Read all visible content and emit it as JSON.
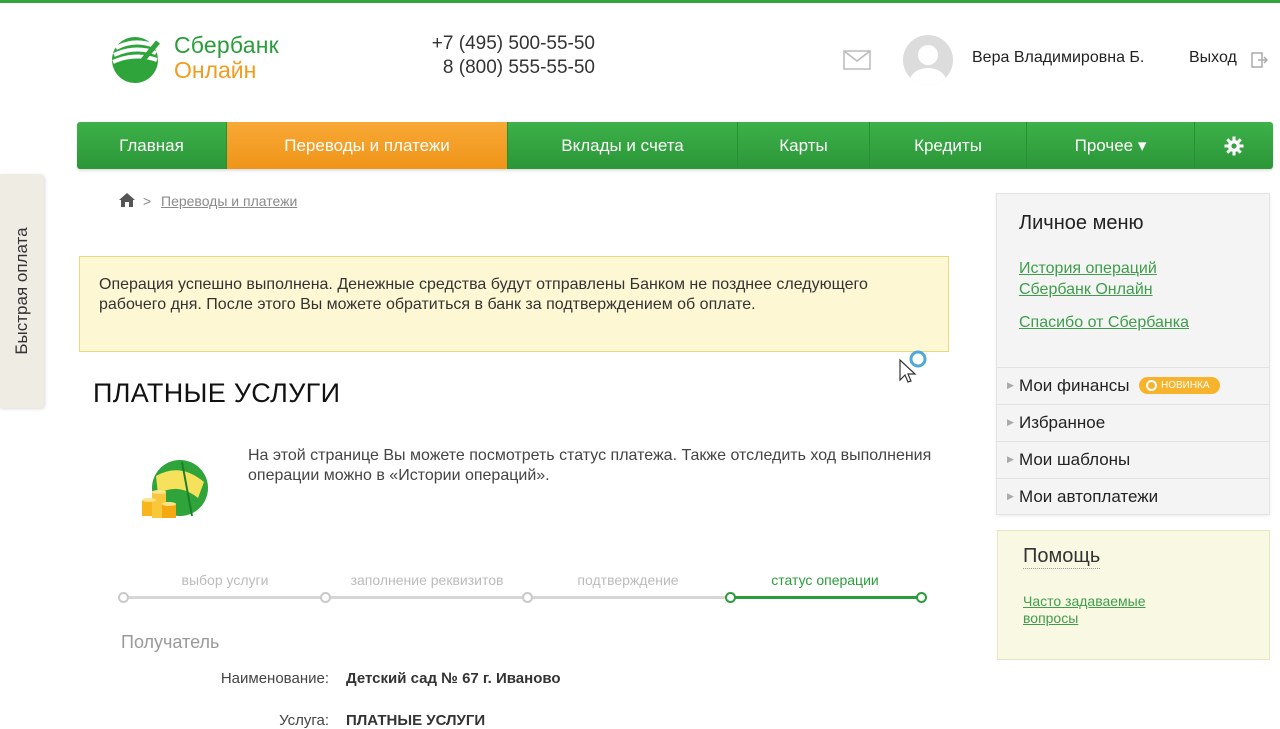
{
  "brand": {
    "name_line1": "Сбербанк",
    "name_line2": "Онлайн"
  },
  "header": {
    "phone1": "+7 (495) 500-55-50",
    "phone2": "8 (800) 555-55-50",
    "username": "Вера Владимировна Б.",
    "logout_label": "Выход"
  },
  "nav": {
    "items": [
      {
        "label": "Главная"
      },
      {
        "label": "Переводы и платежи",
        "active": true
      },
      {
        "label": "Вклады и счета"
      },
      {
        "label": "Карты"
      },
      {
        "label": "Кредиты"
      },
      {
        "label": "Прочее ▾"
      }
    ]
  },
  "side_tab": {
    "label": "Быстрая оплата"
  },
  "breadcrumb": {
    "current": "Переводы и платежи"
  },
  "notice": {
    "text": "Операция успешно выполнена. Денежные средства будут отправлены Банком не позднее следующего рабочего дня. После этого Вы можете обратиться в банк за подтверждением об оплате."
  },
  "page": {
    "title": "ПЛАТНЫЕ УСЛУГИ",
    "intro": "На этой странице Вы можете посмотреть статус платежа. Также отследить ход выполнения операции можно в «Истории операций»."
  },
  "steps": [
    {
      "label": "выбор услуги"
    },
    {
      "label": "заполнение реквизитов"
    },
    {
      "label": "подтверждение"
    },
    {
      "label": "статус операции",
      "active": true
    }
  ],
  "recipient": {
    "section_title": "Получатель",
    "name_label": "Наименование:",
    "name_value": "Детский сад № 67 г. Иваново",
    "service_label": "Услуга:",
    "service_value": "ПЛАТНЫЕ УСЛУГИ"
  },
  "personal_menu": {
    "title": "Личное меню",
    "links": [
      {
        "label": "История операций Сбербанк Онлайн"
      },
      {
        "label": "Спасибо от Сбербанка"
      }
    ],
    "items": [
      {
        "label": "Мои финансы",
        "badge": "НОВИНКА"
      },
      {
        "label": "Избранное"
      },
      {
        "label": "Мои шаблоны"
      },
      {
        "label": "Мои автоплатежи"
      }
    ]
  },
  "help": {
    "title": "Помощь",
    "link": "Часто задаваемые вопросы"
  },
  "colors": {
    "brand_green": "#2a9d3a",
    "accent_orange": "#f29b1d",
    "notice_bg": "#fdf8d3"
  }
}
